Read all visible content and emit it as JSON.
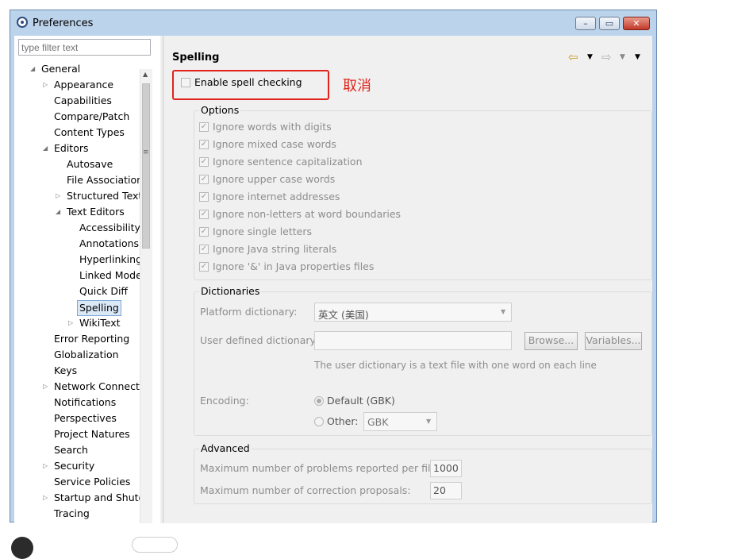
{
  "window": {
    "title": "Preferences",
    "minimize": "–",
    "maximize": "▭",
    "close": "✕"
  },
  "filter": {
    "placeholder": "type filter text"
  },
  "tree": [
    {
      "label": "General",
      "toggle": "◢"
    },
    {
      "label": "Appearance",
      "toggle": "▷"
    },
    {
      "label": "Capabilities"
    },
    {
      "label": "Compare/Patch"
    },
    {
      "label": "Content Types"
    },
    {
      "label": "Editors",
      "toggle": "◢"
    },
    {
      "label": "Autosave"
    },
    {
      "label": "File Associations"
    },
    {
      "label": "Structured Text E",
      "toggle": "▷"
    },
    {
      "label": "Text Editors",
      "toggle": "◢"
    },
    {
      "label": "Accessibility"
    },
    {
      "label": "Annotations"
    },
    {
      "label": "Hyperlinking"
    },
    {
      "label": "Linked Mode"
    },
    {
      "label": "Quick Diff"
    },
    {
      "label": "Spelling"
    },
    {
      "label": "WikiText",
      "toggle": "▷"
    },
    {
      "label": "Error Reporting"
    },
    {
      "label": "Globalization"
    },
    {
      "label": "Keys"
    },
    {
      "label": "Network Connectio",
      "toggle": "▷"
    },
    {
      "label": "Notifications"
    },
    {
      "label": "Perspectives"
    },
    {
      "label": "Project Natures"
    },
    {
      "label": "Search"
    },
    {
      "label": "Security",
      "toggle": "▷"
    },
    {
      "label": "Service Policies"
    },
    {
      "label": "Startup and Shutdo",
      "toggle": "▷"
    },
    {
      "label": "Tracing"
    }
  ],
  "page": {
    "title": "Spelling",
    "enable_spell": "Enable spell checking",
    "annotation": "取消",
    "options_title": "Options",
    "options": [
      "Ignore words with digits",
      "Ignore mixed case words",
      "Ignore sentence capitalization",
      "Ignore upper case words",
      "Ignore internet addresses",
      "Ignore non-letters at word boundaries",
      "Ignore single letters",
      "Ignore Java string literals",
      "Ignore '&' in Java properties files"
    ],
    "dictionaries_title": "Dictionaries",
    "platform_label": "Platform dictionary:",
    "platform_value": "英文 (美国)",
    "user_label": "User defined dictionary:",
    "browse": "Browse...",
    "variables": "Variables...",
    "user_note": "The user dictionary is a text file with one word on each line",
    "encoding_label": "Encoding:",
    "default_enc": "Default (GBK)",
    "other_label": "Other:",
    "other_value": "GBK",
    "advanced_title": "Advanced",
    "max_problems_label": "Maximum number of problems reported per file:",
    "max_problems_value": "1000",
    "max_proposals_label": "Maximum number of correction proposals:",
    "max_proposals_value": "20"
  },
  "colors": {
    "accent_red": "#e0231a",
    "selection": "#dbe9f7"
  }
}
